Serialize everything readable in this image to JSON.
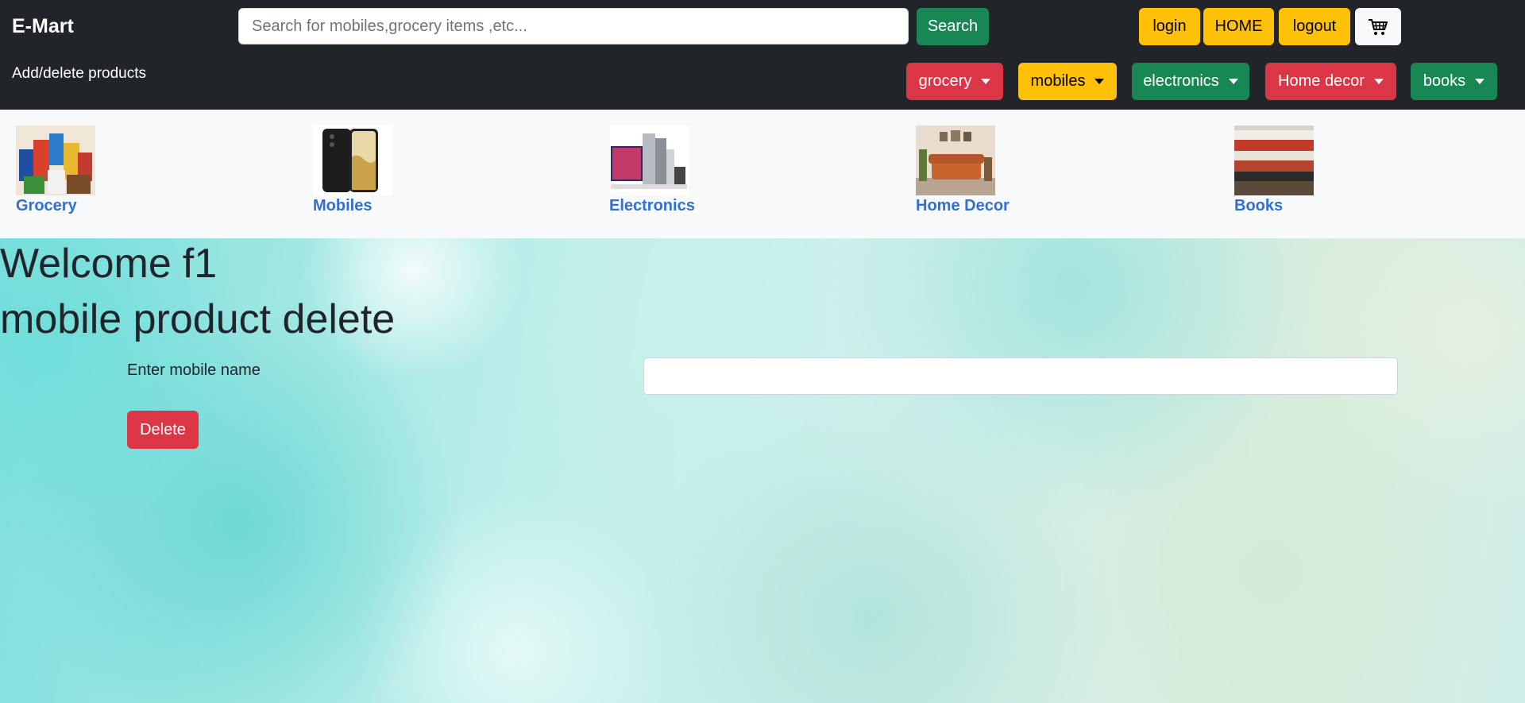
{
  "navbar": {
    "brand": "E-Mart",
    "sub_link": "Add/delete products",
    "search": {
      "placeholder": "Search for mobiles,grocery items ,etc...",
      "value": "",
      "button_label": "Search"
    },
    "actions": {
      "login": "login",
      "home": "HOME",
      "logout": "logout",
      "cart_icon": "cart-icon"
    },
    "dropdowns": [
      {
        "label": "grocery",
        "color": "#dc3545"
      },
      {
        "label": "mobiles",
        "color": "#ffc107"
      },
      {
        "label": "electronics",
        "color": "#198754"
      },
      {
        "label": "Home decor",
        "color": "#dc3545"
      },
      {
        "label": "books",
        "color": "#198754"
      }
    ]
  },
  "categories": [
    {
      "label": "Grocery",
      "image": "grocery-image"
    },
    {
      "label": "Mobiles",
      "image": "mobile-phone-image"
    },
    {
      "label": "Electronics",
      "image": "electronics-image"
    },
    {
      "label": "Home Decor",
      "image": "home-decor-image"
    },
    {
      "label": "Books",
      "image": "books-image"
    }
  ],
  "main": {
    "welcome_prefix": "Welcome",
    "username": "f1",
    "heading": "mobile product delete",
    "form": {
      "label": "Enter mobile name",
      "value": "",
      "submit_label": "Delete"
    }
  },
  "colors": {
    "navbar_bg": "#212529",
    "link_blue": "#2f6fd6",
    "success": "#198754",
    "warning": "#ffc107",
    "danger": "#dc3545"
  }
}
